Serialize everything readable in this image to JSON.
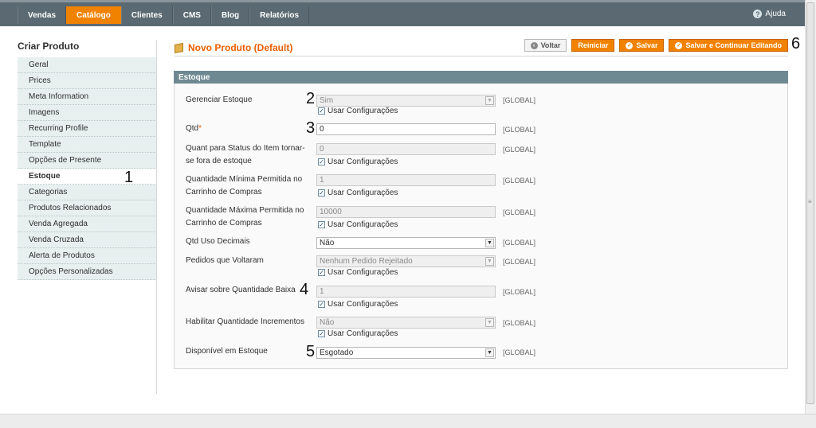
{
  "nav": {
    "items": [
      "Vendas",
      "Catálogo",
      "Clientes",
      "CMS",
      "Blog",
      "Relatórios"
    ],
    "active": "Catálogo",
    "help_label": "Ajuda"
  },
  "sidebar": {
    "title": "Criar Produto",
    "items": [
      {
        "label": "Geral"
      },
      {
        "label": "Prices"
      },
      {
        "label": "Meta Information"
      },
      {
        "label": "Imagens"
      },
      {
        "label": "Recurring Profile"
      },
      {
        "label": "Template"
      },
      {
        "label": "Opções de Presente"
      },
      {
        "label": "Estoque",
        "active": true
      },
      {
        "label": "Categorias"
      },
      {
        "label": "Produtos Relacionados"
      },
      {
        "label": "Venda Agregada"
      },
      {
        "label": "Venda Cruzada"
      },
      {
        "label": "Alerta de Produtos"
      },
      {
        "label": "Opções Personalizadas"
      }
    ]
  },
  "page": {
    "title": "Novo Produto (Default)",
    "buttons": {
      "back": "Voltar",
      "reset": "Reiniciar",
      "save": "Salvar",
      "save_continue": "Salvar e Continuar Editando"
    }
  },
  "fieldset": {
    "title": "Estoque",
    "scope": "[GLOBAL]",
    "use_config": "Usar Configurações",
    "fields": {
      "manage_stock": {
        "label": "Gerenciar Estoque",
        "value": "Sim"
      },
      "qty": {
        "label": "Qtd",
        "required_mark": "*",
        "value": "0"
      },
      "out_of_stock": {
        "label": "Quant para Status do Item tornar-se fora de estoque",
        "value": "0"
      },
      "min_sale": {
        "label": "Quantidade Mínima Permitida no Carrinho de Compras",
        "value": "1"
      },
      "max_sale": {
        "label": "Quantidade Máxima Permitida no Carrinho de Compras",
        "value": "10000"
      },
      "decimals": {
        "label": "Qtd Uso Decimais",
        "value": "Não"
      },
      "backorders": {
        "label": "Pedidos que Voltaram",
        "value": "Nenhum Pedido Rejeitado"
      },
      "notify": {
        "label": "Avisar sobre Quantidade Baixa",
        "value": "1"
      },
      "increments": {
        "label": "Habilitar Quantidade Incrementos",
        "value": "Não"
      },
      "availability": {
        "label": "Disponível em Estoque",
        "value": "Esgotado"
      }
    }
  },
  "annotations": [
    "1",
    "2",
    "3",
    "4",
    "5",
    "6"
  ]
}
